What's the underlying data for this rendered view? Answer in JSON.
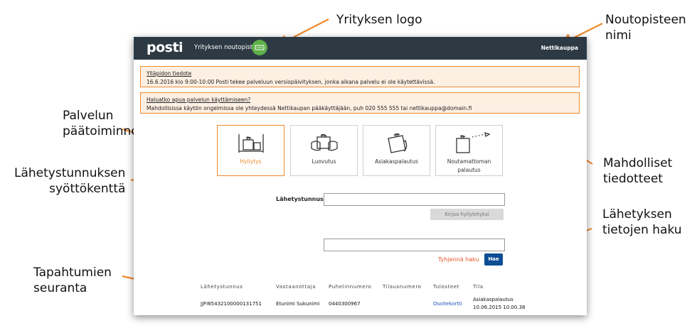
{
  "annotations": {
    "logo": "Yrityksen logo",
    "pickup_name_1": "Noutopisteen",
    "pickup_name_2": "nimi",
    "main_functions_1": "Palvelun",
    "main_functions_2": "päätoiminnot",
    "tracking_field_1": "Lähetystunnuksen",
    "tracking_field_2": "syöttökenttä",
    "notices_1": "Mahdolliset",
    "notices_2": "tiedotteet",
    "search_1": "Lähetyksen",
    "search_2": "tietojen haku",
    "events_1": "Tapahtumien",
    "events_2": "seuranta"
  },
  "colors": {
    "accent": "#f08a2c",
    "topbar": "#2d3a44",
    "primary_button": "#0d4e95"
  },
  "header": {
    "logo_text": "posti",
    "service_title": "Yrityksen noutopiste",
    "badge_icon": "company-logo-badge",
    "pickup_point_name": "Nettikauppa"
  },
  "notices": [
    {
      "title": "Ylläpidon tiedote",
      "text": "16.6.2016 klo 9:00-10:00 Posti tekee palveluun versiopäivityksen, jonka aikana palvelu ei ole käytettävissä."
    },
    {
      "title": "Haluatko apua palvelun käyttämiseen?",
      "text": "Mahdollisissa käytön ongelmissa ole yhteydessä Nettikaupan pääkäyttäjään, puh 020 555 555 tai nettikauppa@domain.fi"
    }
  ],
  "functions": [
    {
      "label": "Hyllytys",
      "icon": "shelving-icon",
      "active": true
    },
    {
      "label": "Luovutus",
      "icon": "handover-icon",
      "active": false
    },
    {
      "label": "Asiakaspalautus",
      "icon": "customer-return-icon",
      "active": false
    },
    {
      "label": "Noutamattoman palautus",
      "icon": "unclaimed-return-icon",
      "active": false
    }
  ],
  "form": {
    "tracking_label": "Lähetystunnus",
    "tracking_value": "",
    "shelve_button": "Kirjaa hyllytetyksi",
    "search_value": "",
    "clear_link": "Tyhjennä haku",
    "search_button": "Hae"
  },
  "events": {
    "columns": [
      "Lähetystunnus",
      "Vastaanottaja",
      "Puhelinnumero",
      "Tilausnumero",
      "Tulosteet",
      "Tila"
    ],
    "rows": [
      {
        "tracking": "JJFI65432100000131751",
        "recipient": "Etunimi Sukunimi",
        "phone": "0440300967",
        "order": "",
        "prints": "Osoitekortti",
        "status_1": "Asiakaspalautus",
        "status_2": "10.06.2015 10.00.38"
      }
    ]
  }
}
